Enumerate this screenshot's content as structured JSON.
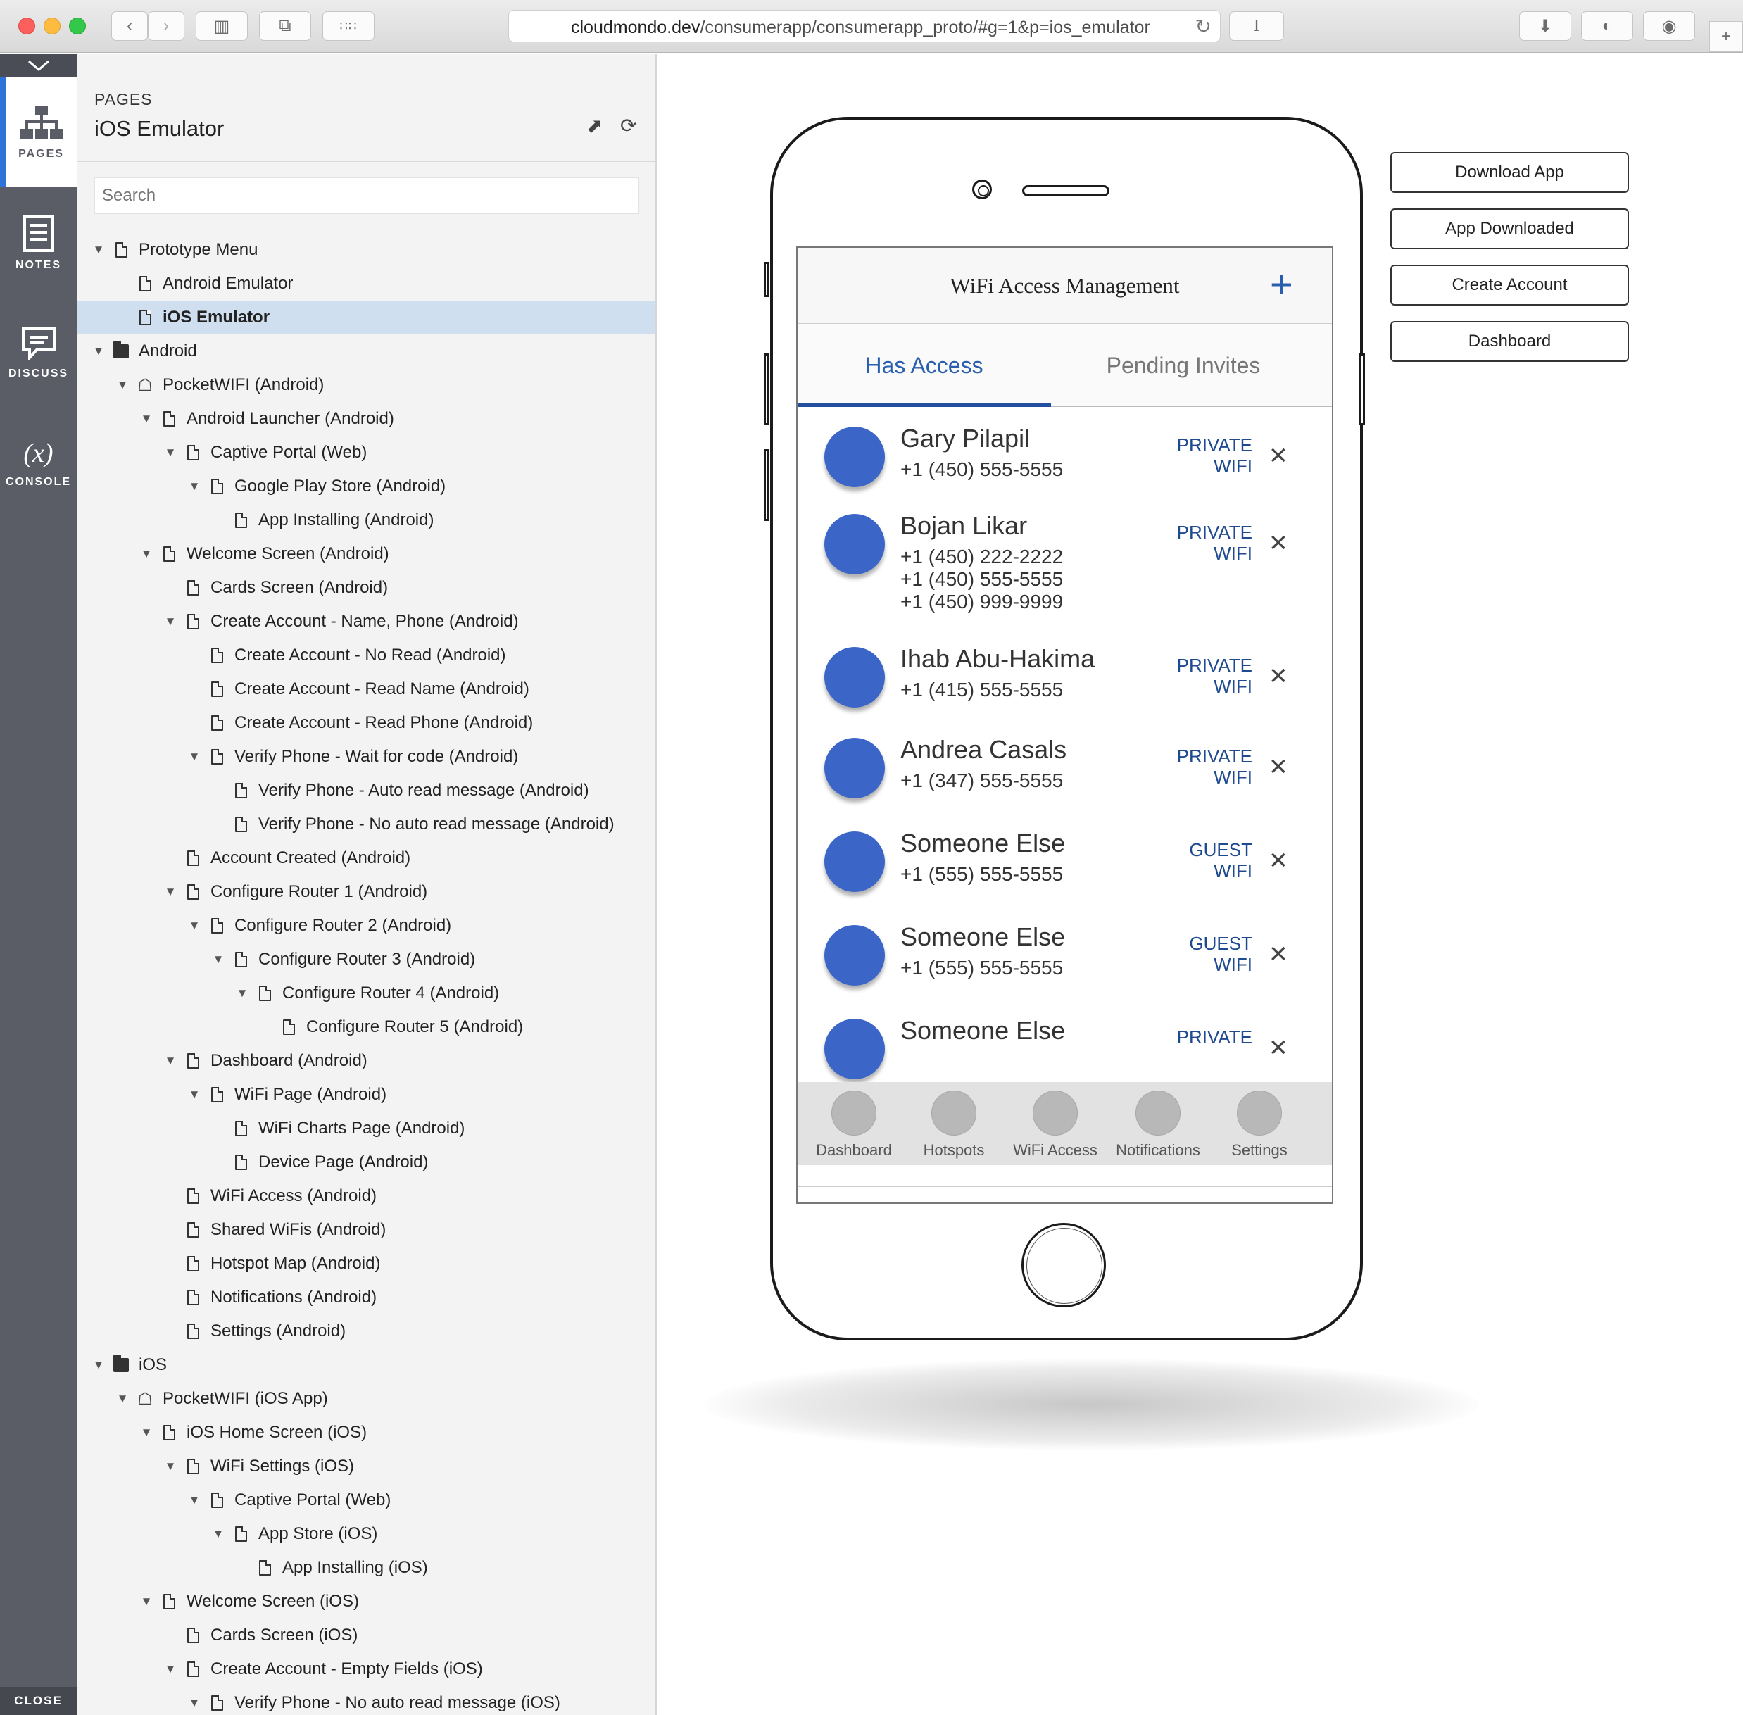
{
  "browser": {
    "url_domain": "cloudmondo.dev",
    "url_path": "/consumerapp/consumerapp_proto/#g=1&p=ios_emulator"
  },
  "rail": {
    "items": [
      {
        "label": "PAGES"
      },
      {
        "label": "NOTES"
      },
      {
        "label": "DISCUSS"
      },
      {
        "label": "CONSOLE"
      }
    ],
    "console_symbol": "(x)",
    "close_label": "CLOSE"
  },
  "panel": {
    "section_label": "PAGES",
    "current_page": "iOS Emulator",
    "search_placeholder": "Search",
    "tree": [
      {
        "label": "Prototype Menu",
        "depth": 0,
        "icon": "page",
        "expanded": true
      },
      {
        "label": "Android Emulator",
        "depth": 1,
        "icon": "page"
      },
      {
        "label": "iOS Emulator",
        "depth": 1,
        "icon": "page",
        "selected": true
      },
      {
        "label": "Android",
        "depth": 0,
        "icon": "folder",
        "expanded": true
      },
      {
        "label": "PocketWIFI (Android)",
        "depth": 1,
        "icon": "flow",
        "expanded": true
      },
      {
        "label": "Android Launcher (Android)",
        "depth": 2,
        "icon": "page",
        "expanded": true
      },
      {
        "label": "Captive Portal (Web)",
        "depth": 3,
        "icon": "page",
        "expanded": true
      },
      {
        "label": "Google Play Store (Android)",
        "depth": 4,
        "icon": "page",
        "expanded": true
      },
      {
        "label": "App Installing (Android)",
        "depth": 5,
        "icon": "page"
      },
      {
        "label": "Welcome Screen (Android)",
        "depth": 2,
        "icon": "page",
        "expanded": true
      },
      {
        "label": "Cards Screen (Android)",
        "depth": 3,
        "icon": "page"
      },
      {
        "label": "Create Account - Name, Phone (Android)",
        "depth": 3,
        "icon": "page",
        "expanded": true
      },
      {
        "label": "Create Account - No Read (Android)",
        "depth": 4,
        "icon": "page"
      },
      {
        "label": "Create Account - Read Name (Android)",
        "depth": 4,
        "icon": "page"
      },
      {
        "label": "Create Account - Read Phone (Android)",
        "depth": 4,
        "icon": "page"
      },
      {
        "label": "Verify Phone - Wait for code (Android)",
        "depth": 4,
        "icon": "page",
        "expanded": true
      },
      {
        "label": "Verify Phone - Auto read message (Android)",
        "depth": 5,
        "icon": "page"
      },
      {
        "label": "Verify Phone - No auto read message (Android)",
        "depth": 5,
        "icon": "page"
      },
      {
        "label": "Account Created (Android)",
        "depth": 3,
        "icon": "page"
      },
      {
        "label": "Configure Router 1 (Android)",
        "depth": 3,
        "icon": "page",
        "expanded": true
      },
      {
        "label": "Configure Router 2 (Android)",
        "depth": 4,
        "icon": "page",
        "expanded": true
      },
      {
        "label": "Configure Router 3 (Android)",
        "depth": 5,
        "icon": "page",
        "expanded": true
      },
      {
        "label": "Configure Router 4 (Android)",
        "depth": 6,
        "icon": "page",
        "expanded": true
      },
      {
        "label": "Configure Router 5 (Android)",
        "depth": 7,
        "icon": "page"
      },
      {
        "label": "Dashboard (Android)",
        "depth": 3,
        "icon": "page",
        "expanded": true
      },
      {
        "label": "WiFi Page (Android)",
        "depth": 4,
        "icon": "page",
        "expanded": true
      },
      {
        "label": "WiFi Charts Page (Android)",
        "depth": 5,
        "icon": "page"
      },
      {
        "label": "Device Page (Android)",
        "depth": 5,
        "icon": "page"
      },
      {
        "label": "WiFi Access (Android)",
        "depth": 3,
        "icon": "page"
      },
      {
        "label": "Shared WiFis (Android)",
        "depth": 3,
        "icon": "page"
      },
      {
        "label": "Hotspot Map (Android)",
        "depth": 3,
        "icon": "page"
      },
      {
        "label": "Notifications (Android)",
        "depth": 3,
        "icon": "page"
      },
      {
        "label": "Settings (Android)",
        "depth": 3,
        "icon": "page"
      },
      {
        "label": "iOS",
        "depth": 0,
        "icon": "folder",
        "expanded": true
      },
      {
        "label": "PocketWIFI (iOS App)",
        "depth": 1,
        "icon": "flow",
        "expanded": true
      },
      {
        "label": "iOS Home Screen (iOS)",
        "depth": 2,
        "icon": "page",
        "expanded": true
      },
      {
        "label": "WiFi Settings (iOS)",
        "depth": 3,
        "icon": "page",
        "expanded": true
      },
      {
        "label": "Captive Portal (Web)",
        "depth": 4,
        "icon": "page",
        "expanded": true
      },
      {
        "label": "App Store (iOS)",
        "depth": 5,
        "icon": "page",
        "expanded": true
      },
      {
        "label": "App Installing (iOS)",
        "depth": 6,
        "icon": "page"
      },
      {
        "label": "Welcome Screen (iOS)",
        "depth": 2,
        "icon": "page",
        "expanded": true
      },
      {
        "label": "Cards Screen (iOS)",
        "depth": 3,
        "icon": "page"
      },
      {
        "label": "Create Account - Empty Fields (iOS)",
        "depth": 3,
        "icon": "page",
        "expanded": true
      },
      {
        "label": "Verify Phone - No auto read message (iOS)",
        "depth": 4,
        "icon": "page",
        "expanded": true
      }
    ]
  },
  "app": {
    "title": "WiFi Access Management",
    "add_symbol": "+",
    "tabs": [
      {
        "label": "Has Access",
        "active": true
      },
      {
        "label": "Pending Invites",
        "active": false
      }
    ],
    "contacts": [
      {
        "name": "Gary Pilapil",
        "phones": [
          "+1 (450) 555-5555"
        ],
        "type_line1": "PRIVATE",
        "type_line2": "WIFI"
      },
      {
        "name": "Bojan Likar",
        "phones": [
          "+1 (450) 222-2222",
          "+1 (450) 555-5555",
          "+1 (450) 999-9999"
        ],
        "type_line1": "PRIVATE",
        "type_line2": "WIFI"
      },
      {
        "name": "Ihab Abu-Hakima",
        "phones": [
          "+1 (415) 555-5555"
        ],
        "type_line1": "PRIVATE",
        "type_line2": "WIFI"
      },
      {
        "name": "Andrea Casals",
        "phones": [
          "+1 (347) 555-5555"
        ],
        "type_line1": "PRIVATE",
        "type_line2": "WIFI"
      },
      {
        "name": "Someone Else",
        "phones": [
          "+1 (555) 555-5555"
        ],
        "type_line1": "GUEST",
        "type_line2": "WIFI"
      },
      {
        "name": "Someone Else",
        "phones": [
          "+1 (555) 555-5555"
        ],
        "type_line1": "GUEST",
        "type_line2": "WIFI"
      },
      {
        "name": "Someone Else",
        "phones": [],
        "type_line1": "PRIVATE",
        "type_line2": ""
      }
    ],
    "remove_symbol": "×",
    "tabbar": [
      {
        "label": "Dashboard"
      },
      {
        "label": "Hotspots"
      },
      {
        "label": "WiFi Access"
      },
      {
        "label": "Notifications"
      },
      {
        "label": "Settings"
      }
    ]
  },
  "proto_buttons": [
    {
      "label": "Download App"
    },
    {
      "label": "App Downloaded"
    },
    {
      "label": "Create Account"
    },
    {
      "label": "Dashboard"
    }
  ],
  "colors": {
    "accent": "#2a5fb0",
    "avatar": "#3b66c8",
    "rail": "#5a5c66",
    "selection": "#cfdfef"
  }
}
